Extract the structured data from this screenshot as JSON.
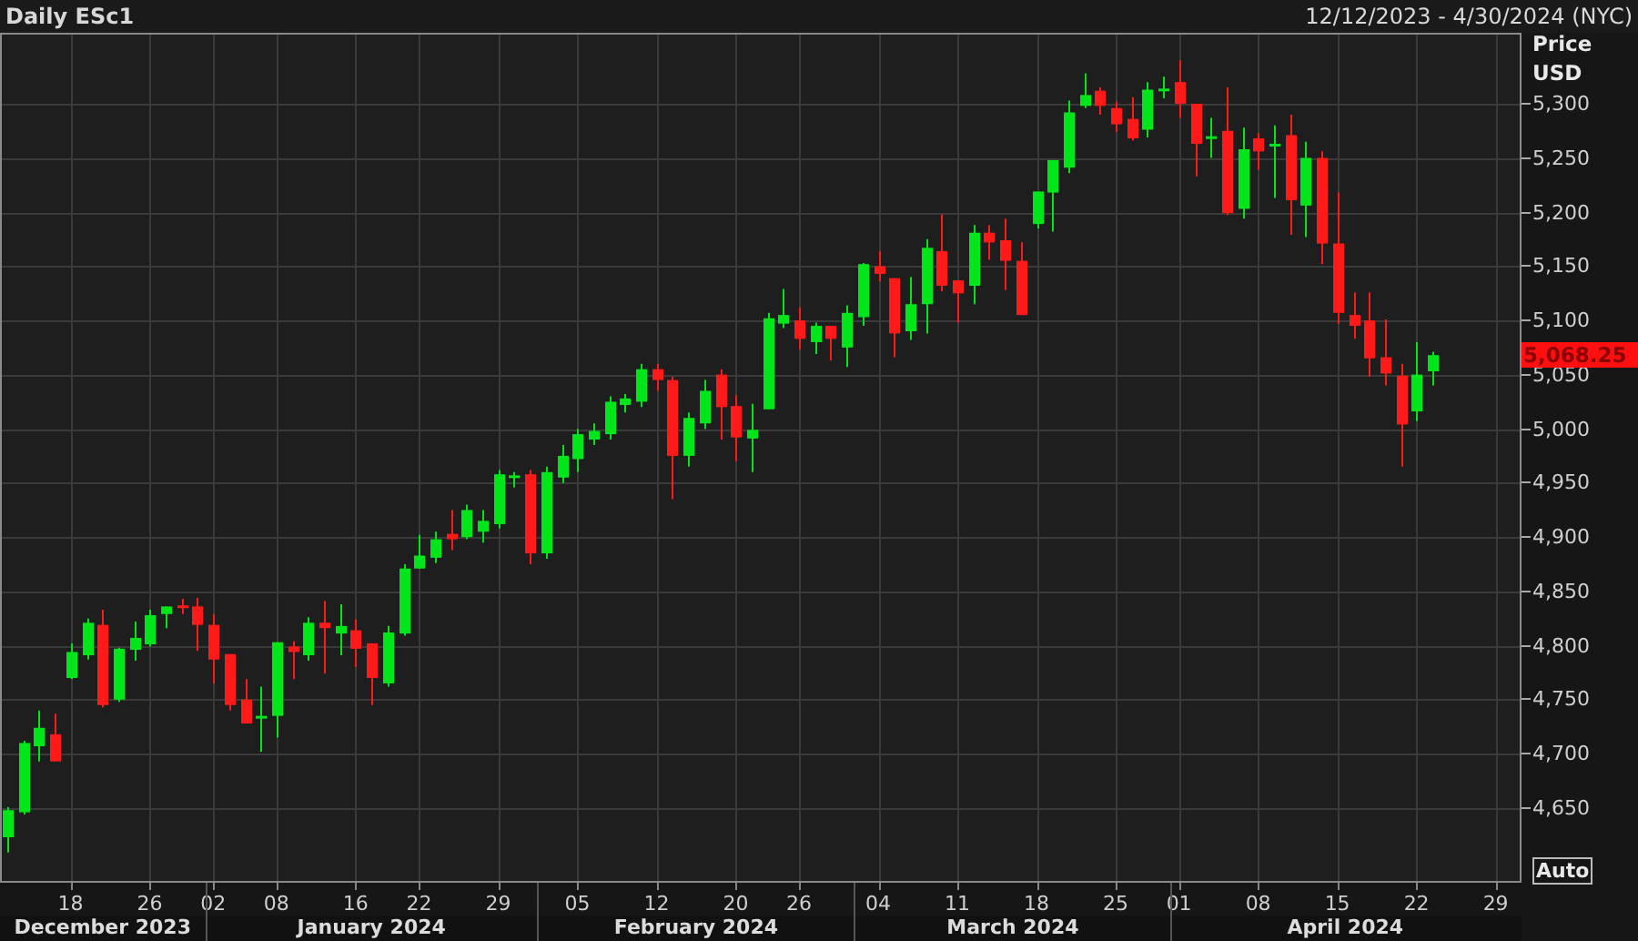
{
  "header": {
    "title": "Daily ESc1",
    "date_range": "12/12/2023 - 4/30/2024 (NYC)"
  },
  "chart": {
    "chart_data": {
      "type": "candlestick",
      "categories": [
        null,
        null,
        null,
        null,
        "18",
        null,
        null,
        null,
        null,
        "26",
        null,
        null,
        null,
        "02",
        null,
        null,
        null,
        "08",
        null,
        null,
        null,
        null,
        "16",
        null,
        null,
        null,
        "22",
        null,
        null,
        null,
        null,
        "29",
        null,
        null,
        null,
        null,
        "05",
        null,
        null,
        null,
        null,
        "12",
        null,
        null,
        null,
        null,
        "20",
        null,
        null,
        null,
        "26",
        null,
        null,
        null,
        null,
        "04",
        null,
        null,
        null,
        null,
        "11",
        null,
        null,
        null,
        null,
        "18",
        null,
        null,
        null,
        null,
        "25",
        null,
        null,
        null,
        "01",
        null,
        null,
        null,
        null,
        "08",
        null,
        null,
        null,
        null,
        "15",
        null,
        null,
        null,
        null,
        "22",
        null,
        null,
        null,
        null,
        "29",
        null
      ],
      "ohlc": [
        [
          4623,
          4651,
          4609,
          4648
        ],
        [
          4646,
          4712,
          4644,
          4710
        ],
        [
          4707,
          4740,
          4693,
          4724
        ],
        [
          4718,
          4737,
          4693,
          4693
        ],
        [
          4770,
          4802,
          4769,
          4794
        ],
        [
          4791,
          4825,
          4787,
          4821
        ],
        [
          4819,
          4833,
          4743,
          4745
        ],
        [
          4750,
          4798,
          4748,
          4797
        ],
        [
          4796,
          4822,
          4786,
          4807
        ],
        [
          4801,
          4833,
          4799,
          4828
        ],
        [
          4829,
          4836,
          4816,
          4836
        ],
        [
          4837,
          4843,
          4829,
          4835
        ],
        [
          4836,
          4844,
          4795,
          4819
        ],
        [
          4819,
          4829,
          4765,
          4787
        ],
        [
          4792,
          4792,
          4740,
          4745
        ],
        [
          4750,
          4769,
          4728,
          4728
        ],
        [
          4733,
          4762,
          4702,
          4735
        ],
        [
          4735,
          4803,
          4715,
          4803
        ],
        [
          4799,
          4804,
          4769,
          4794
        ],
        [
          4791,
          4826,
          4786,
          4821
        ],
        [
          4821,
          4841,
          4774,
          4816
        ],
        [
          4811,
          4838,
          4791,
          4818
        ],
        [
          4814,
          4824,
          4780,
          4797
        ],
        [
          4802,
          4802,
          4745,
          4770
        ],
        [
          4765,
          4818,
          4762,
          4812
        ],
        [
          4811,
          4875,
          4809,
          4871
        ],
        [
          4871,
          4902,
          4871,
          4883
        ],
        [
          4881,
          4905,
          4876,
          4898
        ],
        [
          4903,
          4925,
          4888,
          4898
        ],
        [
          4900,
          4930,
          4898,
          4925
        ],
        [
          4905,
          4925,
          4895,
          4915
        ],
        [
          4912,
          4962,
          4908,
          4958
        ],
        [
          4955,
          4960,
          4946,
          4957
        ],
        [
          4958,
          4962,
          4875,
          4885
        ],
        [
          4885,
          4965,
          4880,
          4960
        ],
        [
          4955,
          4985,
          4950,
          4975
        ],
        [
          4972,
          5000,
          4960,
          4995
        ],
        [
          4990,
          5005,
          4985,
          4998
        ],
        [
          4995,
          5030,
          4990,
          5025
        ],
        [
          5022,
          5032,
          5015,
          5028
        ],
        [
          5025,
          5060,
          5020,
          5055
        ],
        [
          5055,
          5060,
          5035,
          5045
        ],
        [
          5045,
          5048,
          4935,
          4975
        ],
        [
          4975,
          5015,
          4965,
          5010
        ],
        [
          5005,
          5045,
          5000,
          5035
        ],
        [
          5050,
          5055,
          4990,
          5020
        ],
        [
          5021,
          5031,
          4970,
          4992
        ],
        [
          4991,
          5023,
          4960,
          4999
        ],
        [
          5018,
          5107,
          5018,
          5102
        ],
        [
          5097,
          5129,
          5093,
          5105
        ],
        [
          5100,
          5112,
          5073,
          5083
        ],
        [
          5080,
          5098,
          5069,
          5095
        ],
        [
          5095,
          5095,
          5063,
          5083
        ],
        [
          5075,
          5114,
          5057,
          5107
        ],
        [
          5103,
          5153,
          5095,
          5152
        ],
        [
          5150,
          5164,
          5136,
          5143
        ],
        [
          5139,
          5139,
          5066,
          5088
        ],
        [
          5090,
          5140,
          5082,
          5115
        ],
        [
          5115,
          5175,
          5088,
          5167
        ],
        [
          5164,
          5198,
          5127,
          5132
        ],
        [
          5137,
          5137,
          5098,
          5125
        ],
        [
          5132,
          5188,
          5115,
          5181
        ],
        [
          5181,
          5188,
          5156,
          5172
        ],
        [
          5174,
          5194,
          5128,
          5155
        ],
        [
          5155,
          5172,
          5105,
          5105
        ],
        [
          5189,
          5219,
          5185,
          5219
        ],
        [
          5218,
          5248,
          5182,
          5248
        ],
        [
          5241,
          5303,
          5236,
          5292
        ],
        [
          5298,
          5328,
          5296,
          5308
        ],
        [
          5312,
          5315,
          5290,
          5298
        ],
        [
          5296,
          5302,
          5274,
          5281
        ],
        [
          5286,
          5306,
          5266,
          5268
        ],
        [
          5276,
          5320,
          5269,
          5313
        ],
        [
          5312,
          5325,
          5305,
          5314
        ],
        [
          5320,
          5340,
          5287,
          5300
        ],
        [
          5300,
          5300,
          5233,
          5263
        ],
        [
          5268,
          5287,
          5250,
          5270
        ],
        [
          5275,
          5315,
          5197,
          5199
        ],
        [
          5203,
          5278,
          5194,
          5258
        ],
        [
          5268,
          5273,
          5239,
          5256
        ],
        [
          5262,
          5280,
          5213,
          5263
        ],
        [
          5271,
          5290,
          5179,
          5211
        ],
        [
          5206,
          5265,
          5177,
          5250
        ],
        [
          5250,
          5256,
          5152,
          5171
        ],
        [
          5171,
          5218,
          5097,
          5107
        ],
        [
          5105,
          5126,
          5083,
          5095
        ],
        [
          5100,
          5126,
          5048,
          5065
        ],
        [
          5066,
          5101,
          5040,
          5051
        ],
        [
          5049,
          5060,
          4965,
          5004
        ],
        [
          5016,
          5080,
          5007,
          5050
        ],
        [
          5053,
          5071,
          5040,
          5068
        ],
        null,
        null,
        null,
        null,
        null
      ],
      "ylim": [
        4581,
        5365.5
      ],
      "grid": true,
      "yticks": [
        {
          "value": 5300,
          "label": "5,300"
        },
        {
          "value": 5250,
          "label": "5,250"
        },
        {
          "value": 5200,
          "label": "5,200"
        },
        {
          "value": 5150,
          "label": "5,150"
        },
        {
          "value": 5100,
          "label": "5,100"
        },
        {
          "value": 5050,
          "label": "5,050"
        },
        {
          "value": 5000,
          "label": "5,000"
        },
        {
          "value": 4950,
          "label": "4,950"
        },
        {
          "value": 4900,
          "label": "4,900"
        },
        {
          "value": 4850,
          "label": "4,850"
        },
        {
          "value": 4800,
          "label": "4,800"
        },
        {
          "value": 4750,
          "label": "4,750"
        },
        {
          "value": 4700,
          "label": "4,700"
        },
        {
          "value": 4650,
          "label": "4,650"
        }
      ]
    }
  },
  "date_axis": {
    "months": [
      "December 2023",
      "January 2024",
      "February 2024",
      "March 2024",
      "April 2024"
    ]
  },
  "price_axis": {
    "title": "Price",
    "unit": "USD",
    "last_price": "5,068.25",
    "auto_button": "Auto"
  }
}
